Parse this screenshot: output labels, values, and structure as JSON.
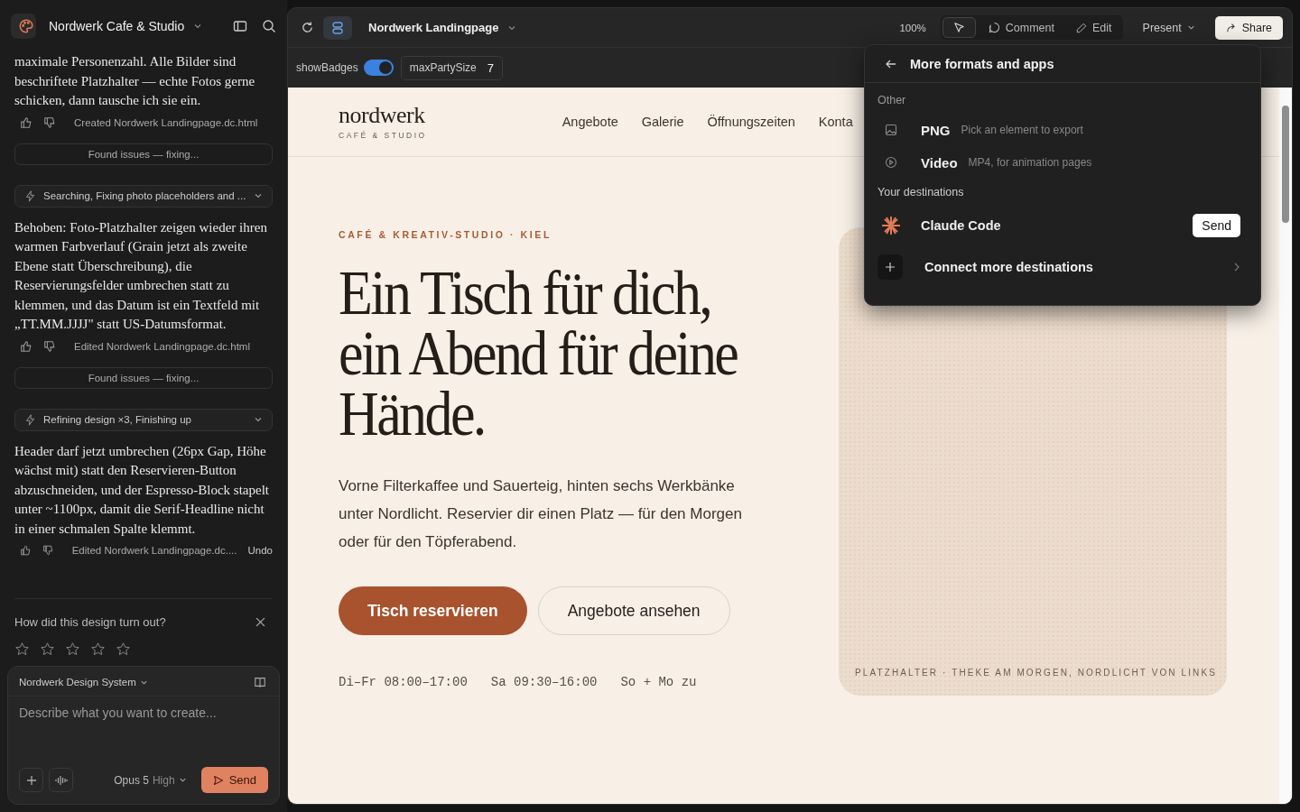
{
  "sidebar": {
    "project": "Nordwerk Cafe & Studio",
    "messages": [
      {
        "kind": "message",
        "text": "maximale Personenzahl. Alle Bilder sind beschriftete Platzhalter — echte Fotos gerne schicken, dann tausche ich sie ein.",
        "file": "Created Nordwerk Landingpage.dc.html"
      },
      {
        "kind": "status",
        "text": "Found issues — fixing..."
      },
      {
        "kind": "step",
        "text": "Searching, Fixing photo placeholders and ..."
      },
      {
        "kind": "message",
        "text": "Behoben: Foto-Platzhalter zeigen wieder ihren warmen Farbverlauf (Grain jetzt als zweite Ebene statt Überschreibung), die Reservierungsfelder umbrechen statt zu klemmen, und das Datum ist ein Textfeld mit „TT.MM.JJJJ\" statt US-Datumsformat.",
        "file": "Edited Nordwerk Landingpage.dc.html"
      },
      {
        "kind": "status",
        "text": "Found issues — fixing..."
      },
      {
        "kind": "step",
        "text": "Refining design ×3, Finishing up"
      },
      {
        "kind": "message",
        "text": "Header darf jetzt umbrechen (26px Gap, Höhe wächst mit) statt den Reservieren-Button abzuschneiden, und der Espresso-Block stapelt unter ~1100px, damit die Serif-Headline nicht in einer schmalen Spalte klemmt.",
        "file": "Edited Nordwerk Landingpage.dc....",
        "undo": "Undo"
      }
    ],
    "feedback": {
      "question": "How did this design turn out?",
      "stars": 0
    },
    "composer": {
      "design_system": "Nordwerk Design System",
      "placeholder": "Describe what you want to create...",
      "model": "Opus 5",
      "effort": "High",
      "send": "Send"
    }
  },
  "toolbar": {
    "file": "Nordwerk Landingpage",
    "zoom": "100%",
    "comment": "Comment",
    "edit": "Edit",
    "present": "Present",
    "share": "Share"
  },
  "props": [
    {
      "kind": "toggle",
      "label": "showBadges",
      "on": true
    },
    {
      "kind": "number",
      "label": "maxPartySize",
      "value": "7"
    }
  ],
  "page": {
    "logo": "nordwerk",
    "logo_sub": "CAFÉ & STUDIO",
    "nav": [
      "Angebote",
      "Galerie",
      "Öffnungszeiten",
      "Konta"
    ],
    "eyebrow": "CAFÉ & KREATIV-STUDIO · KIEL",
    "headline": [
      "Ein Tisch für dich,",
      "ein Abend für deine",
      "Hände."
    ],
    "intro": "Vorne Filterkaffee und Sauerteig, hinten sechs Werkbänke unter Nordlicht. Reservier dir einen Platz — für den Morgen oder für den Töpferabend.",
    "primary": "Tisch reservieren",
    "secondary": "Angebote ansehen",
    "hours": [
      "Di–Fr 08:00–17:00",
      "Sa 09:30–16:00",
      "So + Mo zu"
    ],
    "photo_caption": "PLATZHALTER · THEKE AM MORGEN, NORDLICHT VON LINKS"
  },
  "popover": {
    "title": "More formats and apps",
    "sections": [
      {
        "heading": "Other",
        "items": [
          {
            "kind": "format",
            "label": "PNG",
            "detail": "Pick an element to export"
          },
          {
            "kind": "format",
            "label": "Video",
            "detail": "MP4, for animation pages"
          }
        ]
      },
      {
        "heading": "Your destinations",
        "items": [
          {
            "kind": "destination",
            "label": "Claude Code",
            "action": "Send"
          },
          {
            "kind": "connect",
            "label": "Connect more destinations"
          }
        ]
      }
    ]
  }
}
